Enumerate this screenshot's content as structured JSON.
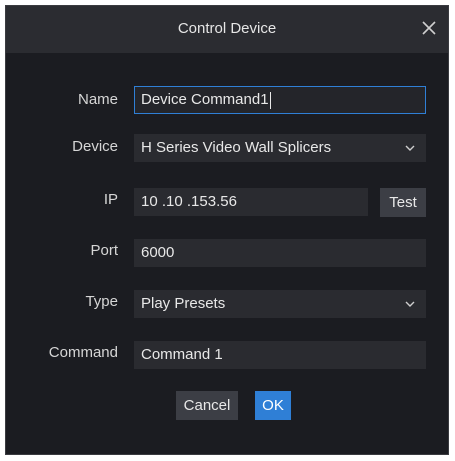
{
  "dialog": {
    "title": "Control Device",
    "close_icon": "close-icon"
  },
  "form": {
    "name": {
      "label": "Name",
      "value": "Device Command1"
    },
    "device": {
      "label": "Device",
      "value": "H Series Video Wall Splicers"
    },
    "ip": {
      "label": "IP",
      "value": "10 .10 .153.56",
      "test_label": "Test"
    },
    "port": {
      "label": "Port",
      "value": "6000"
    },
    "type": {
      "label": "Type",
      "value": "Play Presets"
    },
    "command": {
      "label": "Command",
      "value": "Command 1"
    }
  },
  "footer": {
    "cancel_label": "Cancel",
    "ok_label": "OK"
  },
  "colors": {
    "background": "#1b1c21",
    "titlebar": "#2b2c31",
    "field": "#2a2b30",
    "accent": "#2f7fd6",
    "button": "#3c3e45"
  }
}
